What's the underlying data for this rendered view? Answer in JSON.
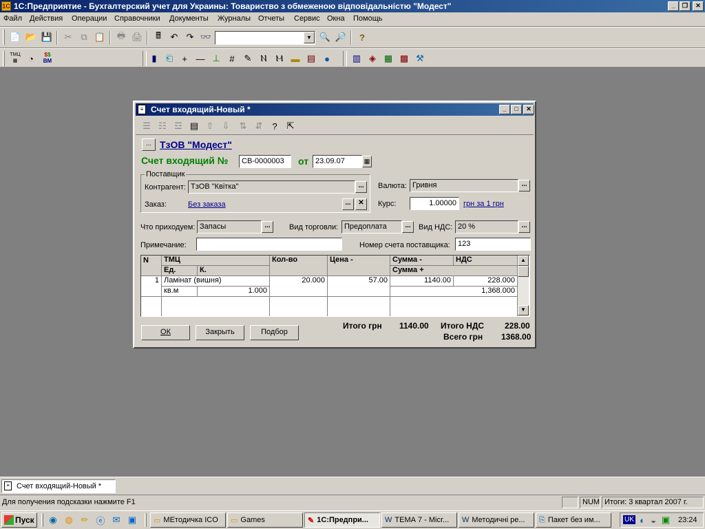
{
  "app": {
    "title": "1С:Предприятие - Бухгалтерский учет для Украины: Товариство  з  обмеженою  відповідальністю  \"Модест\"",
    "menu": [
      "Файл",
      "Действия",
      "Операции",
      "Справочники",
      "Документы",
      "Журналы",
      "Отчеты",
      "Сервис",
      "Окна",
      "Помощь"
    ],
    "search_value": "",
    "toolbar2_labels": [
      "ТМЦ",
      "ВМ"
    ]
  },
  "doc": {
    "title": "Счет входящий-Новый *",
    "org_link": "ТзОВ \"Модест\"",
    "heading": "Счет входящий №",
    "number": "СВ-0000003",
    "date_label": "от",
    "date": "23.09.07",
    "supplier_group": "Поставщик",
    "contractor_label": "Контрагент:",
    "contractor": "ТзОВ \"Квітка\"",
    "order_label": "Заказ:",
    "order_link": "Без заказа",
    "currency_label": "Валюта:",
    "currency": "Гривня",
    "rate_label": "Курс:",
    "rate": "1.00000",
    "rate_link": "грн за 1 грн",
    "receive_label": "Что приходуем:",
    "receive": "Запасы",
    "trade_label": "Вид торговли:",
    "trade": "Предоплата",
    "vat_label": "Вид НДС:",
    "vat": "20 %",
    "note_label": "Примечание:",
    "note": "",
    "supplier_invoice_label": "Номер счета поставщика:",
    "supplier_invoice": "123",
    "table": {
      "headers": {
        "n": "N",
        "tmc": "ТМЦ",
        "unit": "Ед.",
        "coef": "К.",
        "qty": "Кол-во",
        "price": "Цена -",
        "sum_minus": "Сумма -",
        "vat": "НДС",
        "sum_plus": "Сумма +"
      },
      "rows": [
        {
          "n": "1",
          "tmc": "Ламінат (вишня)",
          "unit": "кв.м",
          "coef": "1.000",
          "qty": "20.000",
          "price": "57.00",
          "sum_minus": "1140.00",
          "vat": "228.000",
          "sum_plus": "1,368.000"
        }
      ]
    },
    "buttons": {
      "ok": "ОК",
      "close": "Закрыть",
      "pick": "Подбор"
    },
    "totals": {
      "total_label": "Итого грн",
      "total": "1140.00",
      "vat_label": "Итого НДС",
      "vat_total": "228.00",
      "grand_label": "Всего грн",
      "grand_total": "1368.00"
    }
  },
  "window_bar": {
    "item": "Счет входящий-Новый *"
  },
  "status": {
    "hint": "Для получения подсказки нажмите F1",
    "num": "NUM",
    "totals": "Итоги: 3 квартал 2007 г."
  },
  "taskbar": {
    "start": "Пуск",
    "items": [
      "МЕтодичка ICO",
      "Games",
      "1С:Предпри...",
      "ТЕМА 7 - Micr...",
      "Методичні ре...",
      "Пакет без им..."
    ],
    "lang": "UK",
    "clock": "23:24"
  },
  "colors": {
    "desktop": "#808080",
    "face": "#d4d0c8",
    "title_active": "#0a246a",
    "heading_green": "#008000",
    "link": "#00008b"
  }
}
